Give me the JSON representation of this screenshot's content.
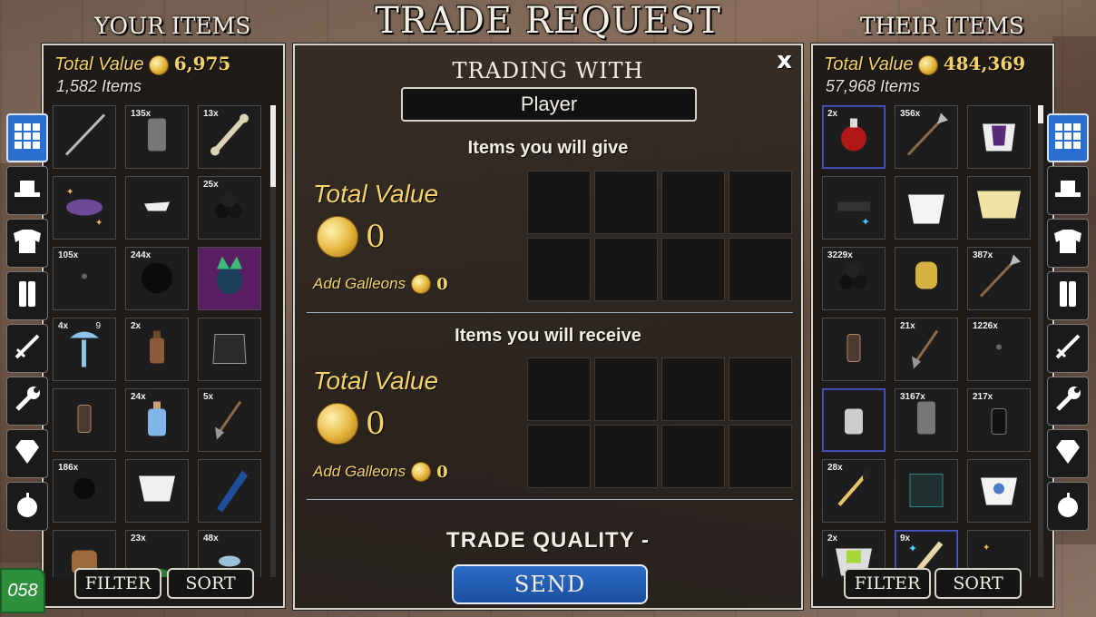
{
  "title": "TRADE REQUEST",
  "left": {
    "header": "YOUR ITEMS",
    "total_value_label": "Total Value",
    "total_value": "6,975",
    "item_count": "1,582 Items",
    "filter": "FILTER",
    "sort": "SORT",
    "items": [
      {
        "qty": "",
        "icon": "spear"
      },
      {
        "qty": "135x",
        "icon": "gray-plate"
      },
      {
        "qty": "13x",
        "icon": "bone"
      },
      {
        "qty": "",
        "icon": "purple-hat"
      },
      {
        "qty": "",
        "icon": "white-scarf"
      },
      {
        "qty": "25x",
        "icon": "cannonballs"
      },
      {
        "qty": "105x",
        "icon": "small-shot"
      },
      {
        "qty": "244x",
        "icon": "cannonball"
      },
      {
        "qty": "",
        "icon": "green-mask"
      },
      {
        "qty": "4x",
        "qty2": "9",
        "icon": "blue-axe"
      },
      {
        "qty": "2x",
        "icon": "brown-bottle"
      },
      {
        "qty": "",
        "icon": "dark-coat"
      },
      {
        "qty": "",
        "icon": "lantern"
      },
      {
        "qty": "24x",
        "icon": "blue-bottle"
      },
      {
        "qty": "5x",
        "icon": "shovel"
      },
      {
        "qty": "186x",
        "icon": "black-ball"
      },
      {
        "qty": "",
        "icon": "white-sash"
      },
      {
        "qty": "",
        "icon": "blue-cloth"
      },
      {
        "qty": "",
        "icon": "chest"
      },
      {
        "qty": "23x",
        "icon": "plant"
      },
      {
        "qty": "48x",
        "icon": "blue-shell"
      }
    ]
  },
  "right": {
    "header": "THEIR ITEMS",
    "total_value_label": "Total Value",
    "total_value": "484,369",
    "item_count": "57,968 Items",
    "filter": "FILTER",
    "sort": "SORT",
    "items": [
      {
        "qty": "2x",
        "icon": "red-potion",
        "sel": true
      },
      {
        "qty": "356x",
        "icon": "spear-head"
      },
      {
        "qty": "",
        "icon": "purple-shirt"
      },
      {
        "qty": "",
        "icon": "cannon-sparkle"
      },
      {
        "qty": "",
        "icon": "white-shirt"
      },
      {
        "qty": "",
        "icon": "gold-sash"
      },
      {
        "qty": "3229x",
        "icon": "cannonballs"
      },
      {
        "qty": "",
        "icon": "gold-skull"
      },
      {
        "qty": "387x",
        "icon": "spear-head"
      },
      {
        "qty": "",
        "icon": "lantern"
      },
      {
        "qty": "21x",
        "icon": "shovel"
      },
      {
        "qty": "1226x",
        "icon": "small-shot"
      },
      {
        "qty": "",
        "icon": "gray-bottle",
        "sel": true
      },
      {
        "qty": "3167x",
        "icon": "gray-plate"
      },
      {
        "qty": "217x",
        "icon": "black-bottle"
      },
      {
        "qty": "28x",
        "icon": "brush"
      },
      {
        "qty": "",
        "icon": "teal-coat"
      },
      {
        "qty": "",
        "icon": "blue-shirt"
      },
      {
        "qty": "2x",
        "icon": "green-shirt"
      },
      {
        "qty": "9x",
        "icon": "sparkle-scroll",
        "sel": true
      },
      {
        "qty": "",
        "icon": "dark-sparkle"
      }
    ]
  },
  "center": {
    "trading_with": "TRADING WITH",
    "player": "Player",
    "give_title": "Items you will give",
    "receive_title": "Items you will receive",
    "total_value_label": "Total Value",
    "give_value": "0",
    "receive_value": "0",
    "add_galleons": "Add Galleons",
    "give_galleons": "0",
    "receive_galleons": "0",
    "quality": "TRADE QUALITY -",
    "send": "SEND",
    "close": "x"
  },
  "tabs": [
    "grid-icon",
    "hat-icon",
    "shirt-icon",
    "pants-icon",
    "sword-icon",
    "wrench-icon",
    "gem-icon",
    "apple-icon"
  ],
  "badge": "058"
}
